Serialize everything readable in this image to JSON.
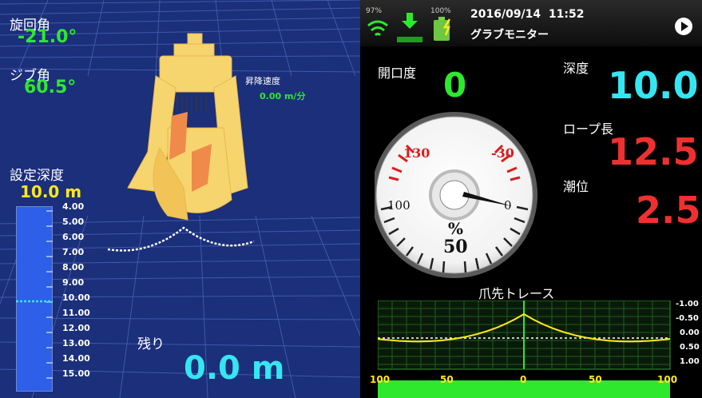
{
  "left_panel": {
    "swing_label": "旋回角",
    "swing_value": "-21.0°",
    "jib_label": "ジブ角",
    "jib_value": "60.5°",
    "hoist_speed_label": "昇降速度",
    "hoist_speed_value": "0.00 m/分",
    "set_depth_label": "設定深度",
    "set_depth_value": "10.0 m",
    "depth_ticks": [
      "4.00",
      "5.00",
      "6.00",
      "7.00",
      "8.00",
      "9.00",
      "10.00",
      "11.00",
      "12.00",
      "13.00",
      "14.00",
      "15.00"
    ],
    "remaining_label": "残り",
    "remaining_value": "0.0 m"
  },
  "status_bar": {
    "wifi_percent": "97%",
    "battery_percent": "100%",
    "datetime": "2016/09/14  11:52",
    "screen_title": "グラブモニター"
  },
  "metrics": {
    "opening_label": "開口度",
    "opening_value": "0",
    "depth_label": "深度",
    "depth_value": "10.0",
    "rope_label": "ロープ長",
    "rope_value": "12.5",
    "tide_label": "潮位",
    "tide_value": "2.5"
  },
  "dial": {
    "label_130": "130",
    "label_m30": "-30",
    "label_100": "100",
    "label_0": "0",
    "label_50": "50",
    "unit": "%",
    "opening_percent": 0
  },
  "trace": {
    "title": "爪先トレース",
    "y_labels": [
      "-1.00",
      "-0.50",
      "0.00",
      "0.50",
      "1.00"
    ],
    "x_labels": [
      "100",
      "50",
      "0",
      "50",
      "100"
    ]
  },
  "colors": {
    "left_bg": "#1b2f7a",
    "green": "#2ee82e",
    "yellow": "#ffe81a",
    "cyan": "#35e6f2",
    "red": "#f03030"
  }
}
